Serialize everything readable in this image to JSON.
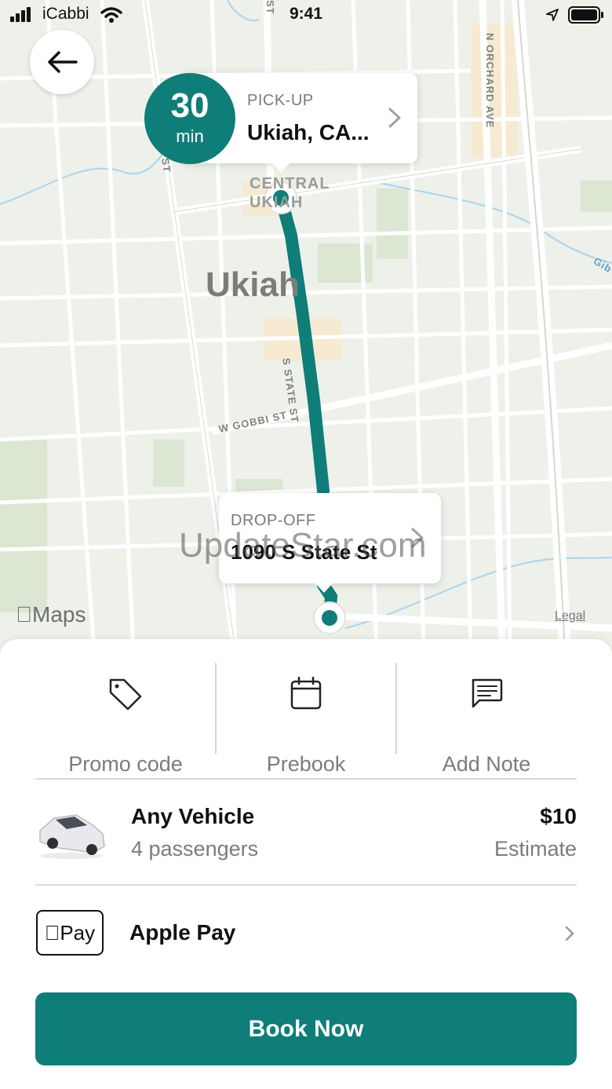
{
  "status_bar": {
    "carrier": "iCabbi",
    "time": "9:41"
  },
  "map": {
    "city_label": "Ukiah",
    "district_label_line1": "CENTRAL",
    "district_label_line2": "UKIAH",
    "streets": [
      "S STATE ST",
      "W GOBBI ST",
      "N ORCHARD AVE",
      "ST",
      "A ST",
      "Gib"
    ],
    "attribution": "Maps",
    "legal": "Legal",
    "watermark": "UpdateStar.com",
    "route_color": "#0f7d78"
  },
  "pickup": {
    "eta_value": "30",
    "eta_unit": "min",
    "kicker": "PICK-UP",
    "address": "Ukiah, CA..."
  },
  "dropoff": {
    "kicker": "DROP-OFF",
    "address": "1090 S State St"
  },
  "options": [
    {
      "label": "Promo code",
      "icon": "tag-icon"
    },
    {
      "label": "Prebook",
      "icon": "calendar-icon"
    },
    {
      "label": "Add Note",
      "icon": "note-icon"
    }
  ],
  "vehicle": {
    "name": "Any Vehicle",
    "subtitle": "4 passengers",
    "price": "$10",
    "price_note": "Estimate"
  },
  "payment": {
    "badge": "Pay",
    "label": "Apple Pay"
  },
  "cta": {
    "label": "Book Now"
  },
  "colors": {
    "accent": "#0f7d78"
  }
}
